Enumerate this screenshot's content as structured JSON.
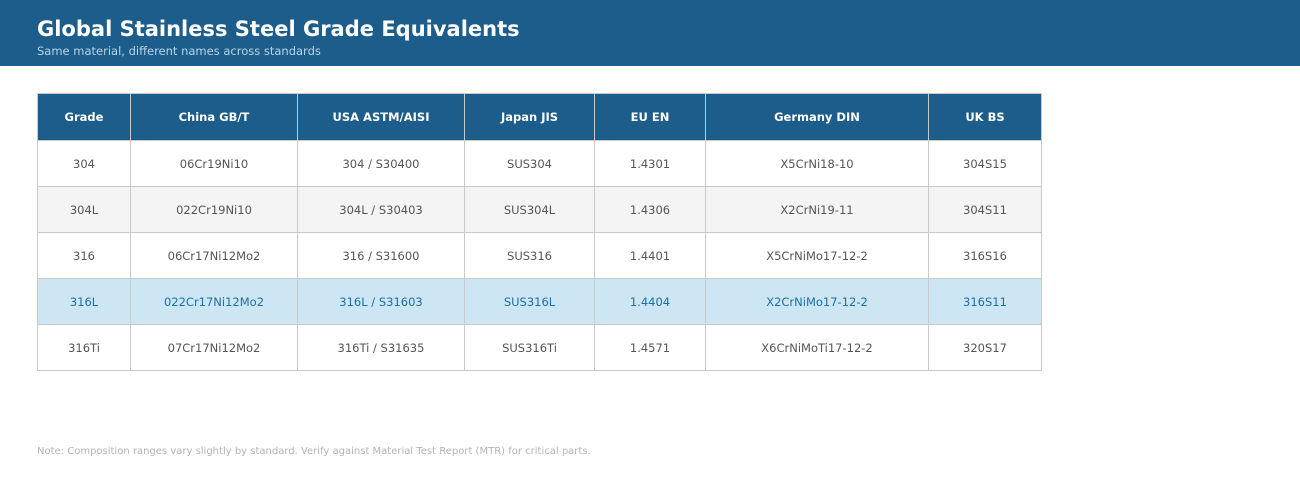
{
  "header": {
    "title": "Global Stainless Steel Grade Equivalents",
    "subtitle": "Same material, different names across standards"
  },
  "colors": {
    "header_bg": "#1d5d8b",
    "highlight_row_bg": "#cde6f3",
    "highlight_row_text": "#1d6fa3",
    "alt_row_bg": "#f4f4f4"
  },
  "table": {
    "columns": [
      "Grade",
      "China GB/T",
      "USA ASTM/AISI",
      "Japan JIS",
      "EU EN",
      "Germany DIN",
      "UK BS"
    ],
    "highlighted_row": 3,
    "rows": [
      [
        "304",
        "06Cr19Ni10",
        "304 / S30400",
        "SUS304",
        "1.4301",
        "X5CrNi18-10",
        "304S15"
      ],
      [
        "304L",
        "022Cr19Ni10",
        "304L / S30403",
        "SUS304L",
        "1.4306",
        "X2CrNi19-11",
        "304S11"
      ],
      [
        "316",
        "06Cr17Ni12Mo2",
        "316 / S31600",
        "SUS316",
        "1.4401",
        "X5CrNiMo17-12-2",
        "316S16"
      ],
      [
        "316L",
        "022Cr17Ni12Mo2",
        "316L / S31603",
        "SUS316L",
        "1.4404",
        "X2CrNiMo17-12-2",
        "316S11"
      ],
      [
        "316Ti",
        "07Cr17Ni12Mo2",
        "316Ti / S31635",
        "SUS316Ti",
        "1.4571",
        "X6CrNiMoTi17-12-2",
        "320S17"
      ]
    ]
  },
  "note": "Note: Composition ranges vary slightly by standard. Verify against Material Test Report (MTR) for critical parts."
}
